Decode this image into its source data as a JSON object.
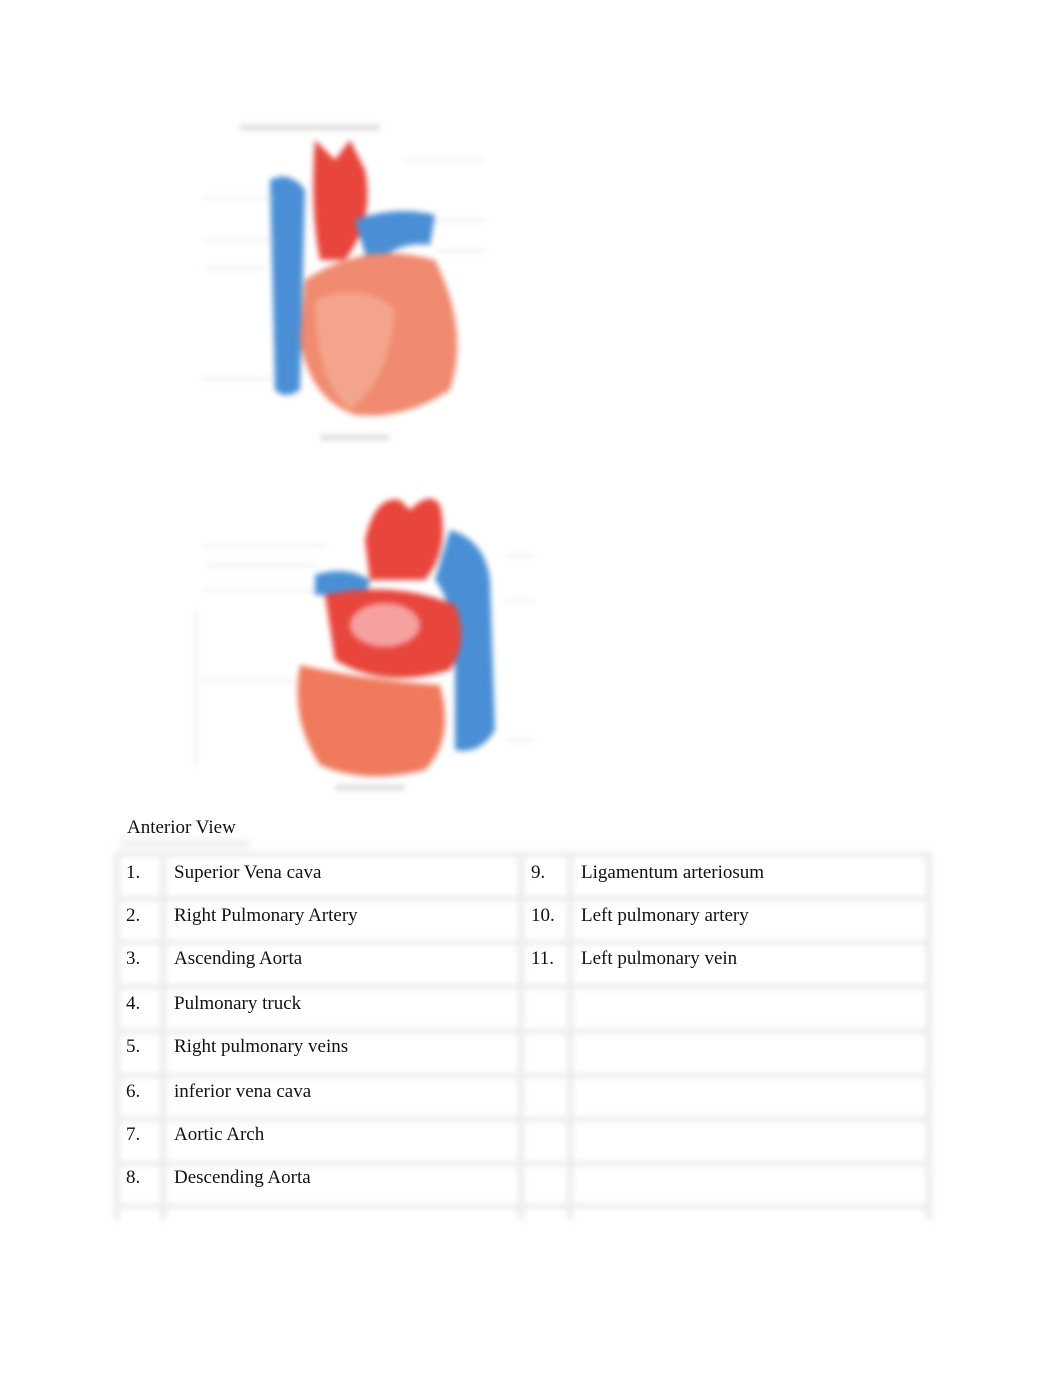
{
  "figures": [
    {
      "name": "heart-anterior-diagram",
      "description": "blurred anterior heart illustration with label leader lines",
      "colors": {
        "artery": "#e8453c",
        "vein": "#4a8fd6",
        "muscle": "#f08a70"
      }
    },
    {
      "name": "heart-posterior-diagram",
      "description": "blurred heart illustration with label leader lines",
      "colors": {
        "artery": "#e8453c",
        "vein": "#4a8fd6",
        "muscle": "#f08a70"
      }
    }
  ],
  "caption": "Anterior View",
  "table": {
    "left": [
      {
        "num": "1.",
        "label": "Superior Vena cava"
      },
      {
        "num": "2.",
        "label": "Right Pulmonary Artery"
      },
      {
        "num": "3.",
        "label": "Ascending Aorta"
      },
      {
        "num": "4.",
        "label": "Pulmonary truck"
      },
      {
        "num": "5.",
        "label": "Right pulmonary veins"
      },
      {
        "num": "6.",
        "label": "inferior vena cava"
      },
      {
        "num": "7.",
        "label": "Aortic Arch"
      },
      {
        "num": "8.",
        "label": "Descending Aorta"
      }
    ],
    "right": [
      {
        "num": "9.",
        "label": "Ligamentum arteriosum"
      },
      {
        "num": "10.",
        "label": "Left pulmonary artery"
      },
      {
        "num": "11.",
        "label": "Left pulmonary vein"
      },
      {
        "num": "",
        "label": ""
      },
      {
        "num": "",
        "label": ""
      },
      {
        "num": "",
        "label": ""
      },
      {
        "num": "",
        "label": ""
      },
      {
        "num": "",
        "label": ""
      }
    ]
  }
}
